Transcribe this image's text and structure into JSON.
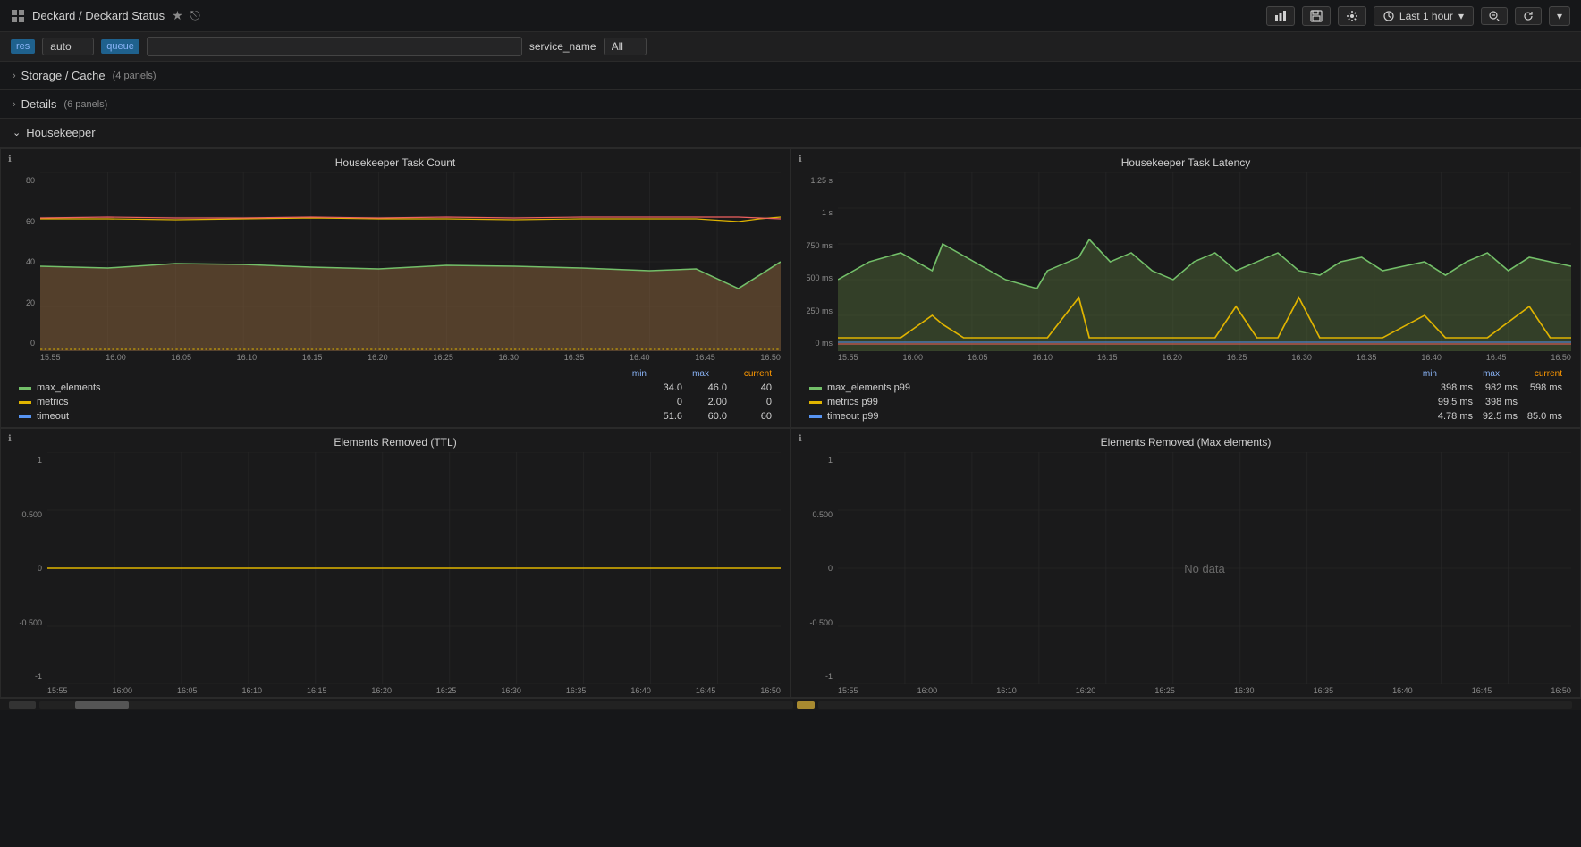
{
  "header": {
    "breadcrumb": "Deckard / Deckard Status",
    "title_label": "Deckard Status",
    "star_icon": "★",
    "share_icon": "⎋",
    "time_range": "Last 1 hour",
    "icons": [
      "bar-chart",
      "save",
      "settings",
      "clock",
      "search",
      "refresh",
      "dropdown"
    ]
  },
  "toolbar": {
    "badge_res": "res",
    "select_auto": "auto",
    "badge_queue": "queue",
    "input_value": "",
    "input_placeholder": "",
    "service_label": "service_name",
    "select_all": "All"
  },
  "sections": [
    {
      "id": "storage-cache",
      "label": "Storage / Cache",
      "count": "(4 panels)",
      "expanded": false,
      "chevron": "›"
    },
    {
      "id": "details",
      "label": "Details",
      "count": "(6 panels)",
      "expanded": false,
      "chevron": "›"
    },
    {
      "id": "housekeeper",
      "label": "Housekeeper",
      "count": "",
      "expanded": true,
      "chevron": "⌄"
    }
  ],
  "panels": {
    "task_count": {
      "title": "Housekeeper Task Count",
      "y_labels": [
        "80",
        "60",
        "40",
        "20",
        "0"
      ],
      "x_labels": [
        "15:55",
        "16:00",
        "16:05",
        "16:10",
        "16:15",
        "16:20",
        "16:25",
        "16:30",
        "16:35",
        "16:40",
        "16:45",
        "16:50"
      ],
      "legend_headers": [
        "min",
        "max",
        "current"
      ],
      "legend": [
        {
          "name": "max_elements",
          "color": "#73bf69",
          "min": "34.0",
          "max": "46.0",
          "current": "40"
        },
        {
          "name": "metrics",
          "color": "#e0b400",
          "min": "0",
          "max": "2.00",
          "current": "0"
        },
        {
          "name": "timeout",
          "color": "#5794f2",
          "min": "51.6",
          "max": "60.0",
          "current": "60"
        }
      ]
    },
    "task_latency": {
      "title": "Housekeeper Task Latency",
      "y_labels": [
        "1.25 s",
        "1 s",
        "750 ms",
        "500 ms",
        "250 ms",
        "0 ms"
      ],
      "x_labels": [
        "15:55",
        "16:00",
        "16:05",
        "16:10",
        "16:15",
        "16:20",
        "16:25",
        "16:30",
        "16:35",
        "16:40",
        "16:45",
        "16:50"
      ],
      "legend_headers": [
        "min",
        "max",
        "current"
      ],
      "legend": [
        {
          "name": "max_elements p99",
          "color": "#73bf69",
          "min": "398 ms",
          "max": "982 ms",
          "current": "598 ms"
        },
        {
          "name": "metrics p99",
          "color": "#e0b400",
          "min": "99.5 ms",
          "max": "398 ms",
          "current": ""
        },
        {
          "name": "timeout p99",
          "color": "#5794f2",
          "min": "4.78 ms",
          "max": "92.5 ms",
          "current": "85.0 ms"
        }
      ]
    },
    "elements_ttl": {
      "title": "Elements Removed (TTL)",
      "y_labels": [
        "1",
        "0.500",
        "0",
        "-0.500",
        "-1"
      ],
      "x_labels": [
        "15:55",
        "16:00",
        "16:05",
        "16:10",
        "16:15",
        "16:20",
        "16:25",
        "16:30",
        "16:35",
        "16:40",
        "16:45",
        "16:50"
      ],
      "has_data": true
    },
    "elements_max": {
      "title": "Elements Removed (Max elements)",
      "y_labels": [
        "1",
        "0.500",
        "0",
        "-0.500",
        "-1"
      ],
      "x_labels": [
        "15:55",
        "16:00",
        "16:10",
        "16:20",
        "16:25",
        "16:30",
        "16:35",
        "16:40",
        "16:45",
        "16:50"
      ],
      "has_data": false,
      "no_data_text": "No data"
    }
  }
}
